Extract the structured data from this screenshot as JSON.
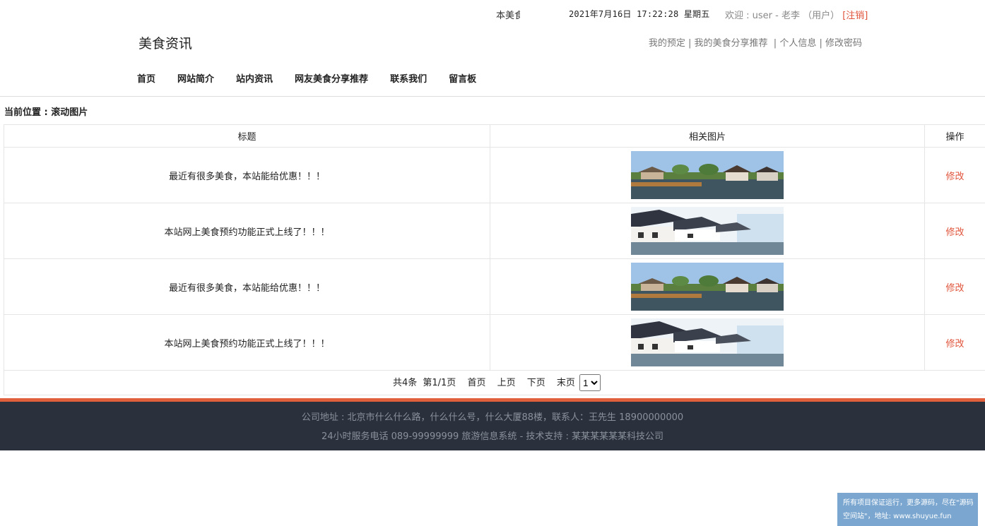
{
  "topbar": {
    "marquee": "本美食",
    "datetime": "2021年7月16日 17:22:28 星期五",
    "welcome": "欢迎 : user - 老李 （用户）",
    "logout": "[注销]"
  },
  "header": {
    "site_title": "美食资讯",
    "links": [
      "我的预定",
      "我的美食分享推荐",
      "个人信息",
      "修改密码"
    ]
  },
  "nav": [
    "首页",
    "网站简介",
    "站内资讯",
    "网友美食分享推荐",
    "联系我们",
    "留言板"
  ],
  "location": "当前位置 : 滚动图片",
  "table": {
    "headers": [
      "标题",
      "相关图片",
      "操作"
    ],
    "rows": [
      {
        "title": "最近有很多美食，本站能给优惠！！！",
        "action": "修改"
      },
      {
        "title": "本站网上美食预约功能正式上线了！！！",
        "action": "修改"
      },
      {
        "title": "最近有很多美食，本站能给优惠！！！",
        "action": "修改"
      },
      {
        "title": "本站网上美食预约功能正式上线了！！！",
        "action": "修改"
      }
    ]
  },
  "pager": {
    "total": "共4条",
    "page": "第1/1页",
    "first": "首页",
    "prev": "上页",
    "next": "下页",
    "last": "末页",
    "select_value": "1"
  },
  "footer": {
    "line1": "公司地址 : 北京市什么什么路，什么什么号，什么大厦88楼，联系人：王先生 18900000000",
    "line2": "24小时服务电话   089-99999999   旅游信息系统 - 技术支持 : 某某某某某某科技公司"
  },
  "notice": {
    "line1": "所有项目保证运行，更多源码，尽在\"源码",
    "line2": "空间站\"，地址: www.shuyue.fun"
  }
}
